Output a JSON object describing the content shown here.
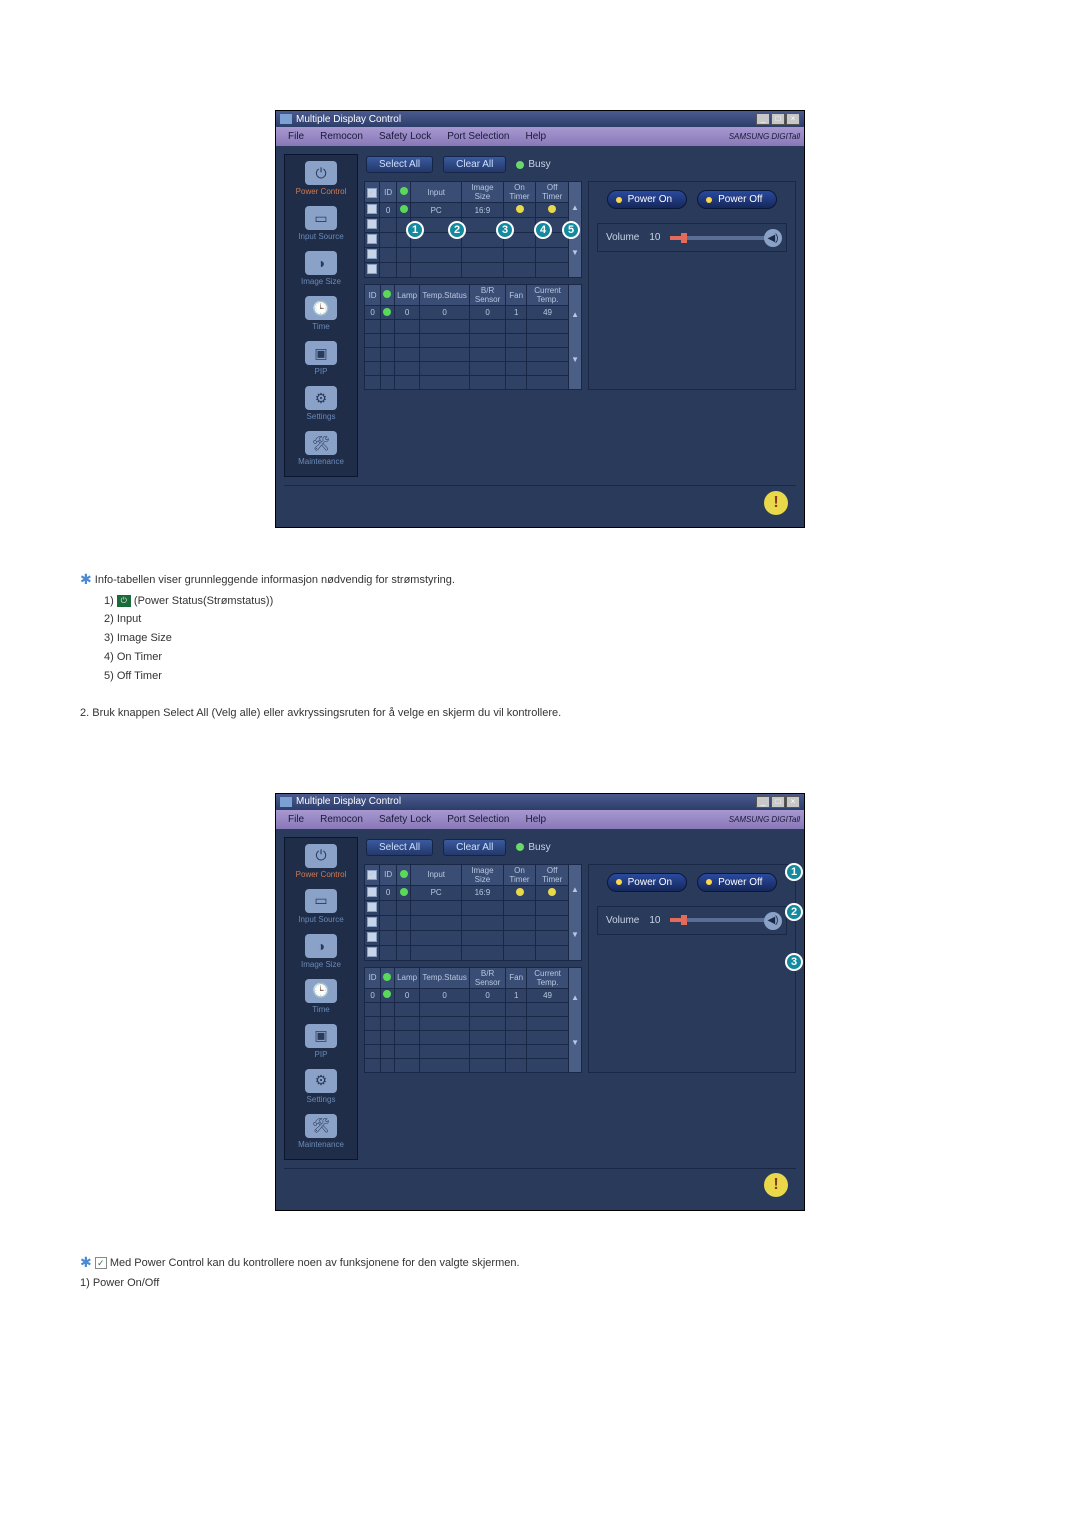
{
  "window": {
    "title": "Multiple Display Control",
    "menus": [
      "File",
      "Remocon",
      "Safety Lock",
      "Port Selection",
      "Help"
    ],
    "brand": "SAMSUNG DIGITall"
  },
  "sidebar": {
    "items": [
      {
        "label": "Power Control"
      },
      {
        "label": "Input Source"
      },
      {
        "label": "Image Size"
      },
      {
        "label": "Time"
      },
      {
        "label": "PIP"
      },
      {
        "label": "Settings"
      },
      {
        "label": "Maintenance"
      }
    ]
  },
  "toolbar": {
    "select_all": "Select All",
    "clear_all": "Clear All",
    "busy": "Busy"
  },
  "top_table": {
    "headers": [
      "",
      "ID",
      "",
      "Input",
      "Image Size",
      "On Timer",
      "Off Timer"
    ],
    "row": {
      "id": "0",
      "input": "PC",
      "image_size": "16:9"
    }
  },
  "bot_table": {
    "headers": [
      "ID",
      "",
      "Lamp",
      "Temp.Status",
      "B/R Sensor",
      "Fan",
      "Current Temp."
    ],
    "row": {
      "id": "0",
      "lamp": "0",
      "temp_status": "0",
      "br": "0",
      "fan": "1",
      "cur_temp": "49"
    }
  },
  "power": {
    "on": "Power On",
    "off": "Power Off",
    "volume_label": "Volume",
    "volume_value": "10"
  },
  "text1": {
    "intro": "Info-tabellen viser grunnleggende informasjon nødvendig for strømstyring.",
    "l1a": "1) ",
    "l1b": " (Power Status(Strømstatus))",
    "l2": "2) Input",
    "l3": "3) Image Size",
    "l4": "4) On Timer",
    "l5": "5) Off Timer",
    "p2": "2.  Bruk knappen Select All (Velg alle) eller avkryssingsruten for å velge en skjerm du vil kontrollere."
  },
  "text2": {
    "intro": " Med Power Control kan du kontrollere noen av funksjonene for den valgte skjermen.",
    "l1": "1)  Power On/Off"
  }
}
